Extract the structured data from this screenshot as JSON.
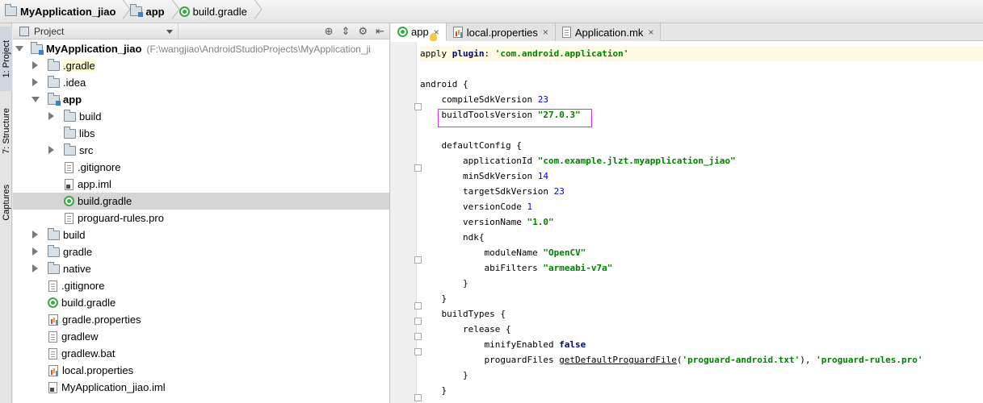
{
  "navbar": {
    "crumbs": [
      {
        "label": "MyApplication_jiao",
        "icon": "folder-icon"
      },
      {
        "label": "app",
        "icon": "module-folder-icon"
      },
      {
        "label": "build.gradle",
        "icon": "gradle-icon"
      }
    ]
  },
  "toolstrip": {
    "tabs": [
      {
        "label": "1: Project"
      },
      {
        "label": "7: Structure"
      },
      {
        "label": "Captures"
      }
    ]
  },
  "panel": {
    "view_label": "Project",
    "tree": [
      {
        "label": "MyApplication_jiao",
        "path": "(F:\\wangjiao\\AndroidStudioProjects\\MyApplication_ji",
        "icon": "module-folder-icon",
        "expanded": true
      },
      {
        "label": ".gradle",
        "icon": "folder-icon"
      },
      {
        "label": ".idea",
        "icon": "folder-icon"
      },
      {
        "label": "app",
        "icon": "module-folder-icon",
        "expanded": true
      },
      {
        "label": "build",
        "icon": "folder-icon"
      },
      {
        "label": "libs",
        "icon": "folder-icon"
      },
      {
        "label": "src",
        "icon": "folder-icon"
      },
      {
        "label": ".gitignore",
        "icon": "file-icon"
      },
      {
        "label": "app.iml",
        "icon": "iml-icon"
      },
      {
        "label": "build.gradle",
        "icon": "gradle-icon"
      },
      {
        "label": "proguard-rules.pro",
        "icon": "file-icon"
      },
      {
        "label": "build",
        "icon": "folder-icon"
      },
      {
        "label": "gradle",
        "icon": "folder-icon"
      },
      {
        "label": "native",
        "icon": "folder-icon"
      },
      {
        "label": ".gitignore",
        "icon": "file-icon"
      },
      {
        "label": "build.gradle",
        "icon": "gradle-icon"
      },
      {
        "label": "gradle.properties",
        "icon": "properties-icon"
      },
      {
        "label": "gradlew",
        "icon": "file-icon"
      },
      {
        "label": "gradlew.bat",
        "icon": "file-icon"
      },
      {
        "label": "local.properties",
        "icon": "properties-icon"
      },
      {
        "label": "MyApplication_jiao.iml",
        "icon": "iml-icon"
      }
    ]
  },
  "editor": {
    "tabs": [
      {
        "label": "app",
        "icon": "gradle-icon",
        "close": "×"
      },
      {
        "label": "local.properties",
        "icon": "properties-icon",
        "close": "×"
      },
      {
        "label": "Application.mk",
        "icon": "file-icon",
        "close": "×"
      }
    ],
    "code": {
      "l1a": "apply ",
      "l1b": "plugin",
      "l1c": ": ",
      "l1d": "'com.android.application'",
      "l2": "android {",
      "l3a": "    compileSdkVersion ",
      "l3b": "23",
      "l4a": "    buildToolsVersion ",
      "l4b": "\"27.0.3\"",
      "l5": "    defaultConfig {",
      "l6a": "        applicationId ",
      "l6b": "\"com.example.jlzt.myapplication_jiao\"",
      "l7a": "        minSdkVersion ",
      "l7b": "14",
      "l8a": "        targetSdkVersion ",
      "l8b": "23",
      "l9a": "        versionCode ",
      "l9b": "1",
      "l10a": "        versionName ",
      "l10b": "\"1.0\"",
      "l11": "        ndk{",
      "l12a": "            moduleName ",
      "l12b": "\"OpenCV\"",
      "l13a": "            abiFilters ",
      "l13b": "\"armeabi-v7a\"",
      "l14": "        }",
      "l15": "    }",
      "l16": "    buildTypes {",
      "l17": "        release {",
      "l18a": "            minifyEnabled ",
      "l18b": "false",
      "l19a": "            proguardFiles ",
      "l19b": "getDefaultProguardFile",
      "l19c": "(",
      "l19d": "'proguard-android.txt'",
      "l19e": "), ",
      "l19f": "'proguard-rules.pro'",
      "l20": "        }",
      "l21": "    }"
    }
  },
  "colors": {
    "highlight_box": "#c93ad0",
    "string": "#008000",
    "keyword": "#000080",
    "number": "#0000ff",
    "selected_row": "#d5d5d5"
  }
}
